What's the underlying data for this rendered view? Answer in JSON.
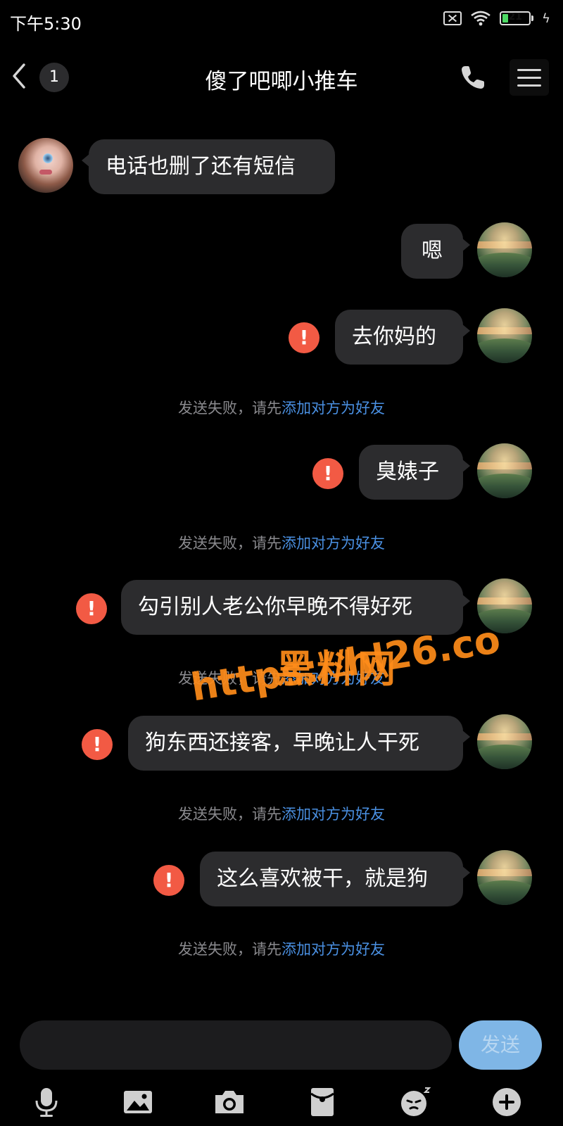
{
  "status": {
    "time": "下午5:30",
    "battery": "21",
    "battery_level_pct": 21
  },
  "nav": {
    "unread_count": "1",
    "title": "傻了吧唧小推车",
    "icons": [
      "back-chevron-icon",
      "phone-icon",
      "menu-icon"
    ]
  },
  "messages": [
    {
      "side": "left",
      "text": "电话也删了还有短信",
      "failed": false
    },
    {
      "side": "right",
      "text": "嗯",
      "failed": false
    },
    {
      "side": "right",
      "text": "去你妈的",
      "failed": true
    },
    {
      "side": "right",
      "text": "臭婊子",
      "failed": true
    },
    {
      "side": "right",
      "text": "勾引别人老公你早晚不得好死",
      "failed": true
    },
    {
      "side": "right",
      "text": "狗东西还接客，早晚让人干死",
      "failed": true
    },
    {
      "side": "right",
      "text": "这么喜欢被干，就是狗",
      "failed": true
    }
  ],
  "fail_notice": {
    "prefix": "发送失败，请先",
    "link": "添加对方为好友"
  },
  "watermark": {
    "name": "黑料网",
    "url": "https://hl26.co"
  },
  "input": {
    "value": "",
    "send_label": "发送"
  },
  "toolbar": {
    "icons": [
      "microphone-icon",
      "image-icon",
      "camera-icon",
      "red-envelope-icon",
      "emoji-icon",
      "plus-icon"
    ]
  },
  "colors": {
    "background": "#000000",
    "bubble": "#2c2c2e",
    "fail_icon": "#f25a44",
    "link": "#4a90e2",
    "send_button": "#7fb6e6",
    "watermark": "#ff8c1a"
  }
}
